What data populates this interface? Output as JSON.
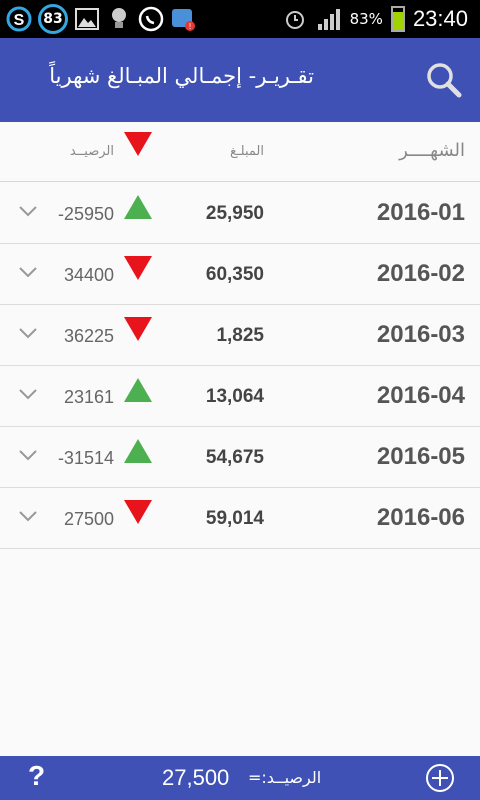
{
  "status_bar": {
    "badge_count": "83",
    "battery_percent": "83%",
    "battery_level": 0.83,
    "time": "23:40",
    "icons": [
      "swype-icon",
      "image-icon",
      "lightbulb-icon",
      "whatsapp-icon",
      "app-update-icon",
      "alarm-icon",
      "signal-icon",
      "battery-icon"
    ]
  },
  "app_bar": {
    "title": "تقـريـر- إجمـالي المبـالغ شهرياً",
    "search_icon": "search-icon"
  },
  "header": {
    "month_label": "الشهــــر",
    "amount_label": "المبلـغ",
    "balance_label": "الرصيــد",
    "arrow": "down"
  },
  "colors": {
    "primary": "#3f51b5",
    "up": "#4caf50",
    "down": "#e8141c"
  },
  "rows": [
    {
      "month": "2016-01",
      "amount": "25,950",
      "balance": "-25950",
      "trend": "up"
    },
    {
      "month": "2016-02",
      "amount": "60,350",
      "balance": "34400",
      "trend": "down"
    },
    {
      "month": "2016-03",
      "amount": "1,825",
      "balance": "36225",
      "trend": "down"
    },
    {
      "month": "2016-04",
      "amount": "13,064",
      "balance": "23161",
      "trend": "up"
    },
    {
      "month": "2016-05",
      "amount": "54,675",
      "balance": "-31514",
      "trend": "up"
    },
    {
      "month": "2016-06",
      "amount": "59,014",
      "balance": "27500",
      "trend": "down"
    }
  ],
  "bottom_bar": {
    "help_label": "?",
    "balance_label": "الرصيــد:=",
    "balance_value": "27,500",
    "add_icon": "add-circle-icon"
  }
}
